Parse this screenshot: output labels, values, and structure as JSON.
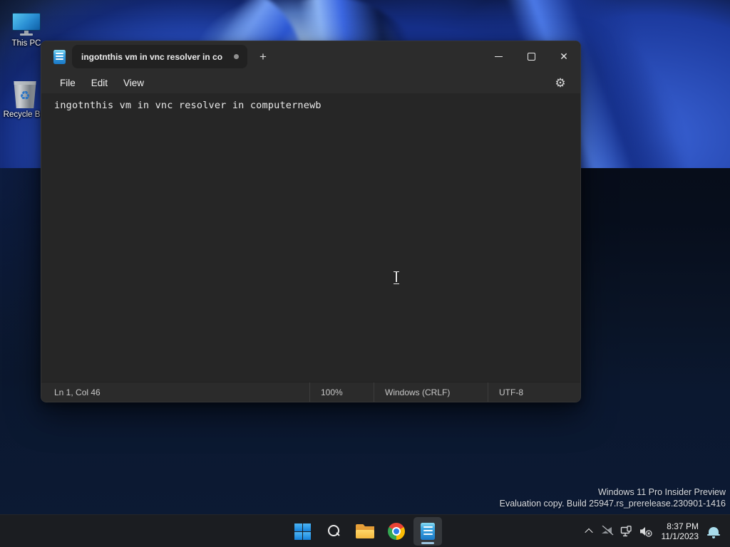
{
  "desktop": {
    "icons": [
      {
        "label": "This PC"
      },
      {
        "label": "Recycle Bin"
      }
    ],
    "watermark_line1": "Windows 11 Pro Insider Preview",
    "watermark_line2": "Evaluation copy. Build 25947.rs_prerelease.230901-1416"
  },
  "notepad": {
    "tab_title": "ingotnthis vm in vnc resolver in co",
    "menu": {
      "file": "File",
      "edit": "Edit",
      "view": "View"
    },
    "content_line1": "ingotnthis vm in vnc resolver in computernewb",
    "statusbar": {
      "cursor_position": "Ln 1, Col 46",
      "zoom": "100%",
      "line_ending": "Windows (CRLF)",
      "encoding": "UTF-8"
    }
  },
  "taskbar": {
    "clock": {
      "time": "8:37 PM",
      "date": "11/1/2023"
    }
  },
  "glyphs": {
    "new_tab": "+",
    "close": "✕",
    "gear": "⚙",
    "recycle": "♻"
  },
  "colors": {
    "accent_blue": "#2f6fe4",
    "window_chrome": "#2c2c2c",
    "editor_bg": "#262626",
    "taskbar_bg": "#1b1d21",
    "bell": "#a9dcec"
  }
}
